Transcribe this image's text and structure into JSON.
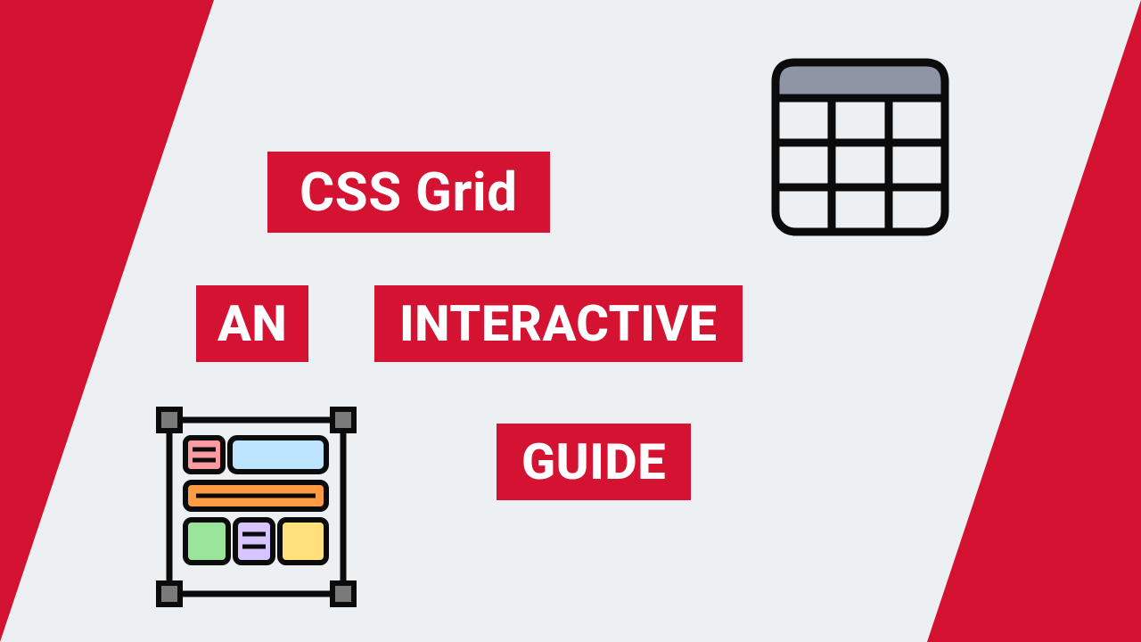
{
  "title": {
    "line1": "CSS Grid",
    "line2a": "AN",
    "line2b": "INTERACTIVE",
    "line3": "GUIDE"
  },
  "colors": {
    "accent": "#d41231",
    "bg": "#ecf0f3"
  }
}
